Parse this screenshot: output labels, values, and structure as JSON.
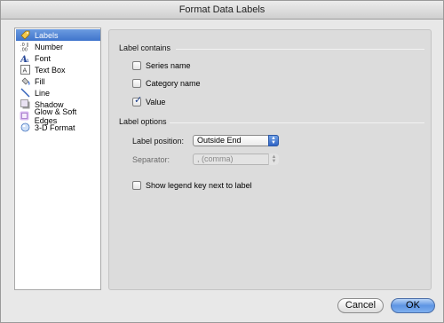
{
  "window": {
    "title": "Format Data Labels"
  },
  "sidebar": {
    "items": [
      {
        "label": "Labels",
        "icon": "labels-tag-icon",
        "selected": true
      },
      {
        "label": "Number",
        "icon": "number-format-icon",
        "selected": false
      },
      {
        "label": "Font",
        "icon": "font-icon",
        "selected": false
      },
      {
        "label": "Text Box",
        "icon": "text-box-icon",
        "selected": false
      },
      {
        "label": "Fill",
        "icon": "fill-bucket-icon",
        "selected": false
      },
      {
        "label": "Line",
        "icon": "line-icon",
        "selected": false
      },
      {
        "label": "Shadow",
        "icon": "shadow-icon",
        "selected": false
      },
      {
        "label": "Glow & Soft Edges",
        "icon": "glow-icon",
        "selected": false
      },
      {
        "label": "3-D Format",
        "icon": "three-d-format-icon",
        "selected": false
      }
    ]
  },
  "label_contains": {
    "heading": "Label contains",
    "series_name": {
      "label": "Series name",
      "checked": false
    },
    "category_name": {
      "label": "Category name",
      "checked": false
    },
    "value": {
      "label": "Value",
      "checked": true
    }
  },
  "label_options": {
    "heading": "Label options",
    "position": {
      "label": "Label position:",
      "value": "Outside End"
    },
    "separator": {
      "label": "Separator:",
      "value": ", (comma)",
      "enabled": false
    },
    "legend_key": {
      "label": "Show legend key next to label",
      "checked": false
    }
  },
  "buttons": {
    "cancel": "Cancel",
    "ok": "OK"
  },
  "colors": {
    "selection": "#3f74cc",
    "default_button": "#5d94e3"
  }
}
